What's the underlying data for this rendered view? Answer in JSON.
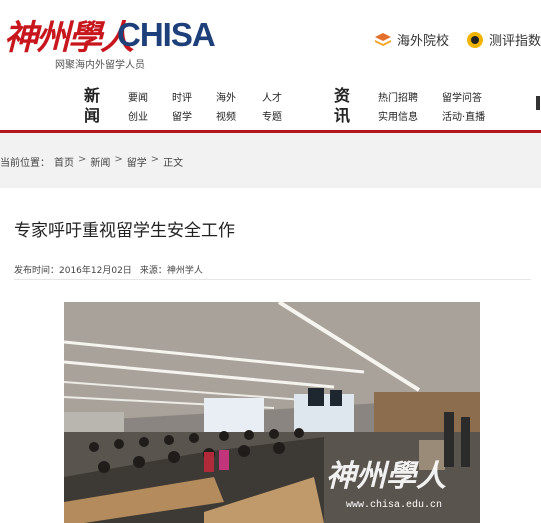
{
  "site": {
    "logo_cn": "神州學人",
    "logo_en": "CHISA",
    "slogan": "网聚海内外留学人员",
    "links": [
      {
        "label": "海外院校",
        "icon": "stack-icon"
      },
      {
        "label": "测评指数",
        "icon": "medal-icon"
      }
    ]
  },
  "nav": {
    "groups": [
      {
        "title": "新闻",
        "items": [
          [
            "要闻",
            "时评",
            "海外",
            "人才"
          ],
          [
            "创业",
            "留学",
            "视频",
            "专题"
          ]
        ]
      },
      {
        "title": "资讯",
        "items": [
          [
            "热门招聘",
            "留学问答"
          ],
          [
            "实用信息",
            "活动·直播"
          ]
        ]
      }
    ]
  },
  "breadcrumb": {
    "prefix": "当前位置：",
    "items": [
      "首页",
      "新闻",
      "留学",
      "正文"
    ],
    "separator": ">"
  },
  "article": {
    "title": "专家呼吁重视留学生安全工作",
    "date": "发布时间：2016年12月02日",
    "source": "来源：神州学人",
    "watermark_cn": "神州學人",
    "watermark_url": "www.chisa.edu.cn"
  },
  "colors": {
    "brand_red": "#c8161d",
    "brand_blue": "#1d3f7a",
    "accent_line": "#b3181e"
  }
}
